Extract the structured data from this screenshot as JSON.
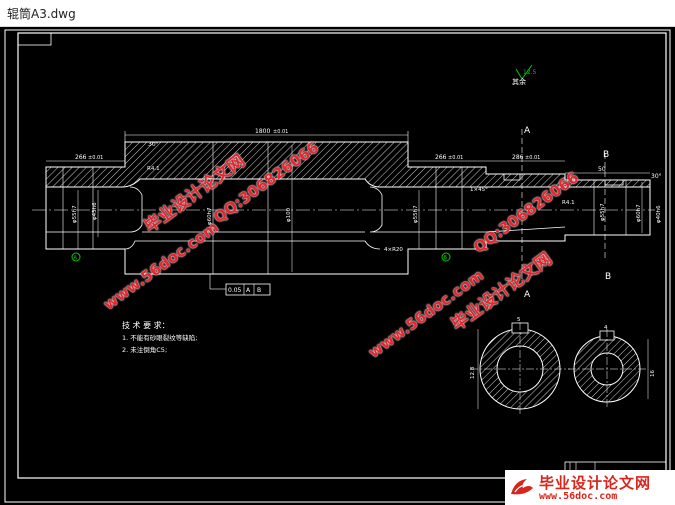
{
  "window": {
    "title": "辊筒A3.dwg"
  },
  "drawing": {
    "roughness_note": "其余",
    "roughness_value": "12.5",
    "overall_length": "1800",
    "overall_tol": "±0.01",
    "left_length": "266",
    "left_tol": "±0.01",
    "mid_length": "266",
    "mid_tol": "±0.01",
    "right_length": "286",
    "right_tol": "±0.01",
    "right_small_length": "50",
    "dia_left": "φ55h7",
    "dia_left_shaft": "φ45h6",
    "dia_mid": "φ55h7",
    "dia_body": "φ100",
    "dia_body_left": "φ60h7",
    "dia_right": "φ60h7",
    "dia_right_end": "φ40h6",
    "dia_right_step": "φ55h7",
    "fillet_left": "R4.1",
    "fillet_right": "R4.1",
    "chamfer_note": "1×45°",
    "groove_note": "4×R20",
    "angle_left": "30°",
    "angle_right": "30°",
    "tol_frame_value": "0.05",
    "tol_frame_ref1": "A",
    "tol_frame_ref2": "B",
    "section_label_a": "A",
    "section_label_b": "B",
    "datum_a": "A",
    "datum_b": "B",
    "tech_title": "技 术 要 求：",
    "tech_req_1": "1. 不能有砂眼裂纹等缺陷;",
    "tech_req_2": "2. 未注倒角C5;",
    "section_a_dim": "12.8",
    "section_b_dim": "16",
    "key_width_a": "5",
    "key_width_b": "4"
  },
  "watermarks": {
    "site_name": "毕业设计论文网",
    "site_url": "www.56doc.com",
    "qq": "QQ:306826066"
  },
  "brand": {
    "title": "毕业设计论文网",
    "url": "www.56doc.com"
  },
  "colors": {
    "background": "#000000",
    "lines": "#ffffff",
    "frame": "#ffffff",
    "green": "#00c800",
    "watermark": "#e8242c"
  }
}
